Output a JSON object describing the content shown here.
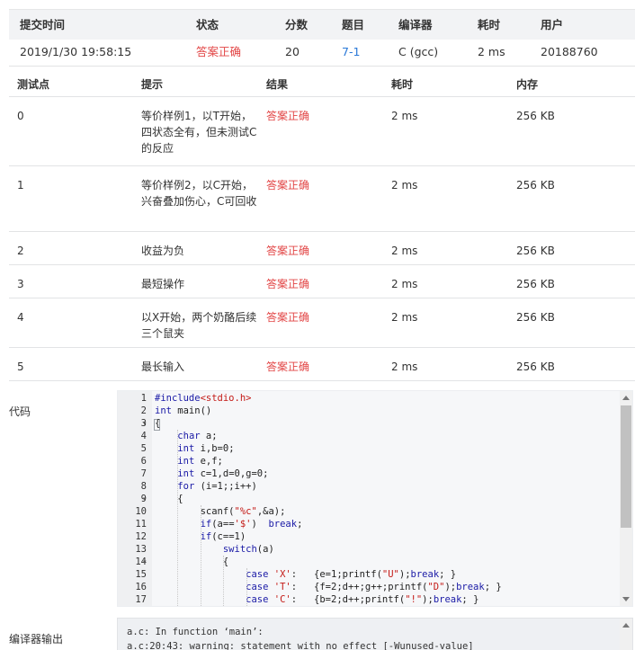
{
  "submission": {
    "headers": [
      "提交时间",
      "状态",
      "分数",
      "题目",
      "编译器",
      "耗时",
      "用户"
    ],
    "time": "2019/1/30 19:58:15",
    "status": "答案正确",
    "score": "20",
    "problem": "7-1",
    "compiler": "C (gcc)",
    "elapsed": "2 ms",
    "user": "20188760"
  },
  "cases_headers": [
    "测试点",
    "提示",
    "结果",
    "耗时",
    "内存"
  ],
  "cases": [
    {
      "id": "0",
      "hint": "等价样例1，以T开始，四状态全有，但未测试C的反应",
      "result": "答案正确",
      "time": "2 ms",
      "memory": "256 KB"
    },
    {
      "id": "1",
      "hint": "等价样例2，以C开始，兴奋叠加伤心，C可回收",
      "result": "答案正确",
      "time": "2 ms",
      "memory": "256 KB"
    },
    {
      "id": "2",
      "hint": "收益为负",
      "result": "答案正确",
      "time": "2 ms",
      "memory": "256 KB"
    },
    {
      "id": "3",
      "hint": "最短操作",
      "result": "答案正确",
      "time": "2 ms",
      "memory": "256 KB"
    },
    {
      "id": "4",
      "hint": "以X开始，两个奶酪后续三个鼠夹",
      "result": "答案正确",
      "time": "2 ms",
      "memory": "256 KB"
    },
    {
      "id": "5",
      "hint": "最长输入",
      "result": "答案正确",
      "time": "2 ms",
      "memory": "256 KB"
    }
  ],
  "code_label": "代码",
  "code_lines": [
    "#include<stdio.h>",
    "int main()",
    "{",
    "    char a;",
    "    int i,b=0;",
    "    int e,f;",
    "    int c=1,d=0,g=0;",
    "    for (i=1;;i++)",
    "    {",
    "        scanf(\"%c\",&a);",
    "        if(a=='$')  break;",
    "        if(c==1)",
    "            switch(a)",
    "            {",
    "                case 'X':   {e=1;printf(\"U\");break; }",
    "                case 'T':   {f=2;d++;g++;printf(\"D\");break; }",
    "                case 'C':   {b=2;d++;printf(\"!\");break; }"
  ],
  "output_label": "编译器输出",
  "output_lines": [
    "a.c: In function ‘main’:",
    "a.c:20:43: warning: statement with no effect [-Wunused-value]"
  ],
  "colors": {
    "accepted": "#e24545",
    "link": "#2a79d8",
    "keyword": "#1a1aa6",
    "string": "#c41a16"
  }
}
